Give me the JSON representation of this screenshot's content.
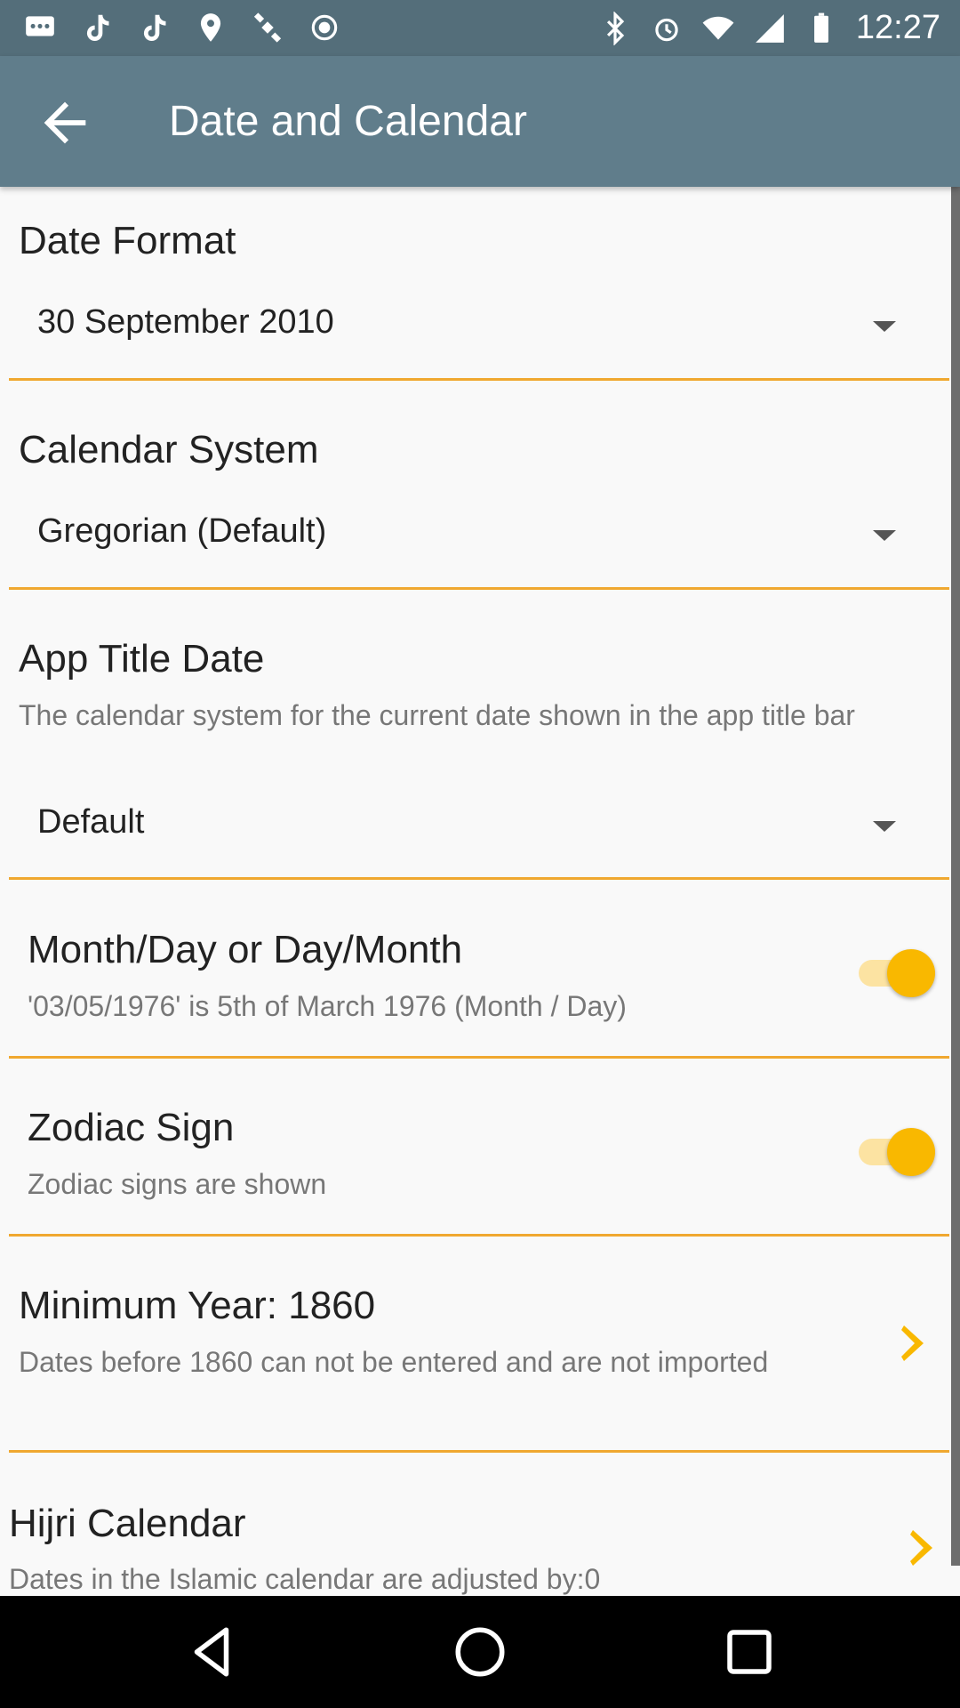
{
  "status_bar": {
    "time": "12:27",
    "left_icons": [
      "chat-icon",
      "tiktok-icon",
      "tiktok-icon",
      "fake-gps-icon",
      "satellite-icon",
      "circle-icon"
    ],
    "right_icons": [
      "bluetooth-icon",
      "alarm-icon",
      "wifi-icon",
      "signal-icon",
      "battery-icon"
    ]
  },
  "app_bar": {
    "title": "Date and Calendar",
    "back_icon": "arrow-left-icon"
  },
  "settings": {
    "date_format": {
      "title": "Date Format",
      "value": "30 September 2010"
    },
    "calendar_system": {
      "title": "Calendar System",
      "value": "Gregorian (Default)"
    },
    "app_title_date": {
      "title": "App Title Date",
      "description": "The calendar system for the current date shown in the app title bar",
      "value": "Default"
    },
    "month_day": {
      "title": "Month/Day or Day/Month",
      "description": "'03/05/1976' is 5th of March 1976 (Month / Day)",
      "enabled": true
    },
    "zodiac": {
      "title": "Zodiac Sign",
      "description": "Zodiac signs are shown",
      "enabled": true
    },
    "minimum_year": {
      "title": "Minimum Year: 1860",
      "description": "Dates before 1860 can not be entered and are not imported"
    },
    "hijri": {
      "title": "Hijri Calendar",
      "description": "Dates in the Islamic calendar are adjusted by:0"
    }
  },
  "colors": {
    "app_bar": "#607d8b",
    "status_bar": "#546e7a",
    "accent": "#f9b800",
    "divider": "#f0a830",
    "background": "#f9f9f9"
  },
  "nav_bar": {
    "icons": [
      "back-triangle-icon",
      "home-circle-icon",
      "recents-square-icon"
    ]
  }
}
